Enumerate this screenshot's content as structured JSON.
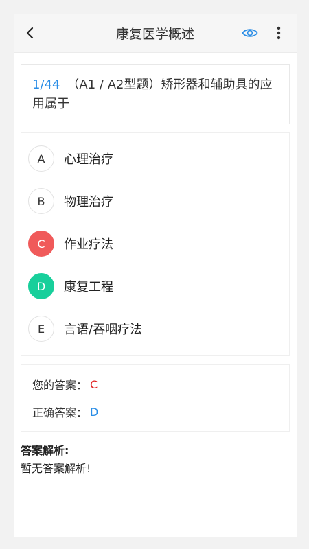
{
  "header": {
    "title": "康复医学概述",
    "icons": [
      "back-chevron-icon",
      "eye-icon",
      "more-vertical-icon"
    ],
    "accent_color": "#2a8de6"
  },
  "question": {
    "number": "1/44",
    "text": "（A1 / A2型题）矫形器和辅助具的应用属于"
  },
  "options": [
    {
      "letter": "A",
      "text": "心理治疗",
      "state": "normal"
    },
    {
      "letter": "B",
      "text": "物理治疗",
      "state": "normal"
    },
    {
      "letter": "C",
      "text": "作业疗法",
      "state": "wrong"
    },
    {
      "letter": "D",
      "text": "康复工程",
      "state": "correct"
    },
    {
      "letter": "E",
      "text": "言语/吞咽疗法",
      "state": "normal"
    }
  ],
  "answers": {
    "yours_label": "您的答案：",
    "yours_value": "C",
    "correct_label": "正确答案：",
    "correct_value": "D"
  },
  "analysis": {
    "label": "答案解析:",
    "content": "暂无答案解析!"
  },
  "colors": {
    "wrong": "#f05a5a",
    "correct": "#18cf9b"
  }
}
